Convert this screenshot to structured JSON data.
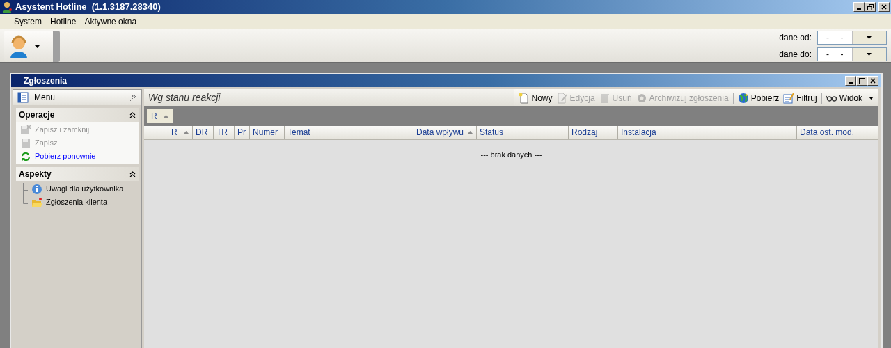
{
  "window": {
    "title": "Asystent Hotline  (1.1.3187.28340)"
  },
  "menu": [
    "System",
    "Hotline",
    "Aktywne okna"
  ],
  "date_filters": [
    {
      "label": "dane od:",
      "value": "-     -"
    },
    {
      "label": "dane do:",
      "value": "-     -"
    }
  ],
  "child_window": {
    "title": "Zgłoszenia"
  },
  "side_panel": {
    "title": "Menu",
    "sections": [
      {
        "title": "Operacje",
        "expanded": true,
        "kind": "actions",
        "items": [
          {
            "label": "Zapisz i zamknij",
            "disabled": true
          },
          {
            "label": "Zapisz",
            "disabled": true
          },
          {
            "label": "Pobierz ponownie",
            "disabled": false
          }
        ]
      },
      {
        "title": "Aspekty",
        "expanded": true,
        "kind": "tree",
        "items": [
          {
            "label": "Uwagi dla użytkownika",
            "disabled": false
          },
          {
            "label": "Zgłoszenia klienta",
            "disabled": false
          }
        ]
      }
    ]
  },
  "view": {
    "title": "Wg stanu reakcji",
    "toolbar": [
      [
        {
          "label": "Nowy",
          "disabled": false,
          "dropdown": false
        },
        {
          "label": "Edycja",
          "disabled": true,
          "dropdown": false
        },
        {
          "label": "Usuń",
          "disabled": true,
          "dropdown": false
        },
        {
          "label": "Archiwizuj zgłoszenia",
          "disabled": true,
          "dropdown": false
        }
      ],
      [
        {
          "label": "Pobierz",
          "disabled": false,
          "dropdown": false
        },
        {
          "label": "Filtruj",
          "disabled": false,
          "dropdown": false
        }
      ],
      [
        {
          "label": "Widok",
          "disabled": false,
          "dropdown": true
        }
      ]
    ],
    "group_by": [
      {
        "label": "R",
        "sorted": true
      }
    ],
    "table": {
      "columns": [
        {
          "label": "R",
          "sorted": true
        },
        {
          "label": "DR",
          "sorted": false
        },
        {
          "label": "TR",
          "sorted": false
        },
        {
          "label": "Pr",
          "sorted": false
        },
        {
          "label": "Numer",
          "sorted": false
        },
        {
          "label": "Temat",
          "sorted": false
        },
        {
          "label": "Data wpływu",
          "sorted": true
        },
        {
          "label": "Status",
          "sorted": false
        },
        {
          "label": "Rodzaj",
          "sorted": false
        },
        {
          "label": "Instalacja",
          "sorted": false
        },
        {
          "label": "Data ost. mod.",
          "sorted": false
        }
      ],
      "empty_text": "--- brak danych ---"
    }
  }
}
